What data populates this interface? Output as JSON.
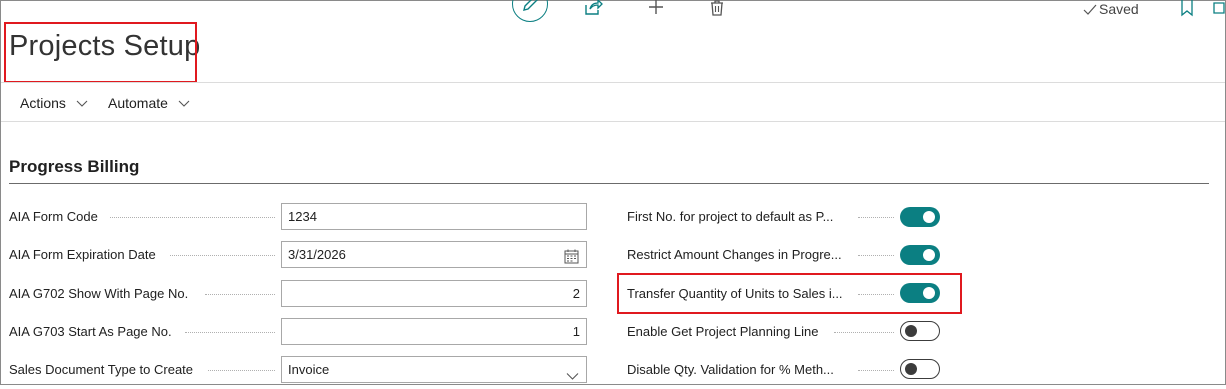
{
  "page": {
    "title": "Projects Setup",
    "status": "Saved"
  },
  "menu": [
    {
      "label": "Actions"
    },
    {
      "label": "Automate"
    }
  ],
  "section": {
    "title": "Progress Billing"
  },
  "left_fields": [
    {
      "label": "AIA Form Code",
      "value": "1234",
      "align": "left"
    },
    {
      "label": "AIA Form Expiration Date",
      "value": "3/31/2026",
      "align": "left",
      "icon": "calendar-icon"
    },
    {
      "label": "AIA G702 Show With Page No.",
      "value": "2",
      "align": "right"
    },
    {
      "label": "AIA G703 Start As Page No.",
      "value": "1",
      "align": "right"
    },
    {
      "label": "Sales Document Type to Create",
      "value": "Invoice",
      "align": "left",
      "icon": "chevron-down-icon"
    }
  ],
  "right_fields": [
    {
      "label": "First No. for project to default as P...",
      "on": true
    },
    {
      "label": "Restrict Amount Changes in Progre...",
      "on": true
    },
    {
      "label": "Transfer Quantity of Units to Sales i...",
      "on": true
    },
    {
      "label": "Enable Get Project Planning Line",
      "on": false
    },
    {
      "label": "Disable Qty. Validation for % Meth...",
      "on": false
    }
  ],
  "colors": {
    "accent": "#0b7f82",
    "highlight": "#e0191f"
  }
}
